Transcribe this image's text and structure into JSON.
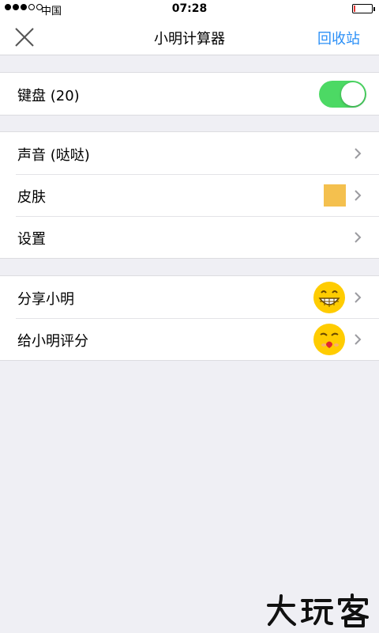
{
  "status_bar": {
    "signal_dots_filled": 3,
    "signal_dots_total": 5,
    "carrier": "中国",
    "time": "07:28",
    "battery_level": 0.1
  },
  "nav": {
    "close_icon": "close-icon",
    "title": "小明计算器",
    "right_action": "回收站"
  },
  "groups": {
    "keyboard": {
      "label": "键盘 (20)",
      "toggle_on": true
    },
    "sound": {
      "label": "声音 (哒哒)"
    },
    "skin": {
      "label": "皮肤",
      "swatch_color": "#f4c04e"
    },
    "settings": {
      "label": "设置"
    },
    "share": {
      "label": "分享小明",
      "icon": "grin-emoji-icon"
    },
    "rate": {
      "label": "给小明评分",
      "icon": "kiss-emoji-icon"
    }
  },
  "colors": {
    "accent": "#2a8ff7",
    "toggle_on": "#4cd964",
    "background": "#efeff4"
  },
  "watermark": {
    "text": "大玩客"
  }
}
